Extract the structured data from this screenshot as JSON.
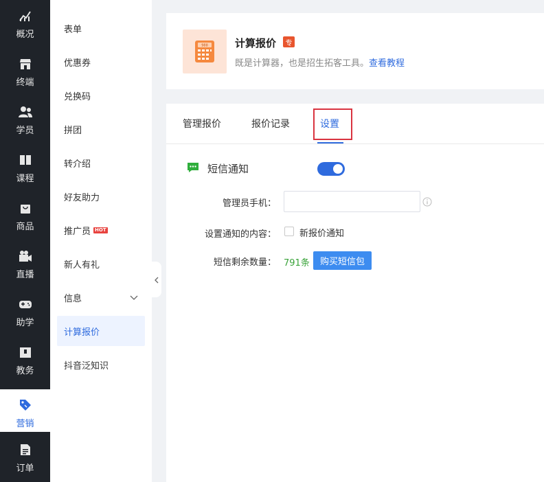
{
  "left_nav": [
    {
      "label": "概况",
      "icon": "chart-trend-icon"
    },
    {
      "label": "终端",
      "icon": "store-icon"
    },
    {
      "label": "学员",
      "icon": "users-icon"
    },
    {
      "label": "课程",
      "icon": "book-icon"
    },
    {
      "label": "商品",
      "icon": "bag-icon"
    },
    {
      "label": "直播",
      "icon": "video-camera-icon"
    },
    {
      "label": "助学",
      "icon": "gamepad-icon"
    },
    {
      "label": "教务",
      "icon": "calendar-icon"
    },
    {
      "label": "营销",
      "icon": "tag-icon",
      "active": true
    },
    {
      "label": "订单",
      "icon": "document-icon"
    }
  ],
  "sub_menu": [
    {
      "label": "表单"
    },
    {
      "label": "优惠券"
    },
    {
      "label": "兑换码"
    },
    {
      "label": "拼团"
    },
    {
      "label": "转介绍"
    },
    {
      "label": "好友助力"
    },
    {
      "label": "推广员",
      "badge": "HOT"
    },
    {
      "label": "新人有礼"
    },
    {
      "label": "信息",
      "expandable": true
    },
    {
      "label": "计算报价",
      "active": true
    },
    {
      "label": "抖音泛知识"
    }
  ],
  "tool": {
    "title": "计算报价",
    "badge": "专",
    "icon_display": "988",
    "desc": "既是计算器，也是招生拓客工具。",
    "link": "查看教程"
  },
  "tabs": [
    {
      "label": "管理报价"
    },
    {
      "label": "报价记录"
    },
    {
      "label": "设置",
      "active": true
    }
  ],
  "settings": {
    "sms_title": "短信通知",
    "sms_enabled": true,
    "phone_label": "管理员手机：",
    "phone_value": "",
    "content_label": "设置通知的内容：",
    "checkbox_label": "新报价通知",
    "checkbox_checked": false,
    "remaining_label": "短信剩余数量：",
    "remaining_value": "791条",
    "buy_button": "购买短信包"
  },
  "colors": {
    "accent": "#2f6bde",
    "nav_bg": "#1f2329",
    "sms_green": "#3aa33a",
    "badge_orange": "#e8552e",
    "highlight_red": "#d9333f"
  }
}
